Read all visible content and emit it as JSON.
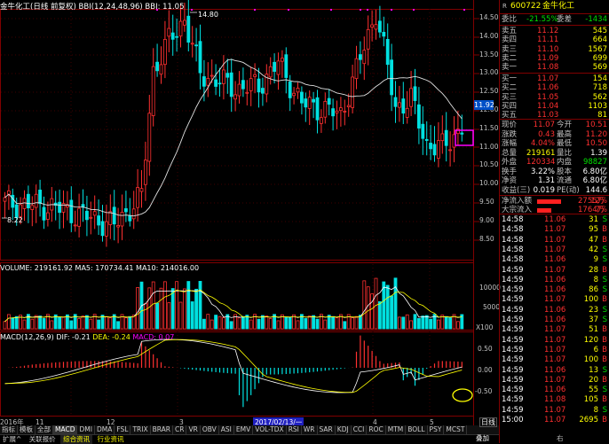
{
  "chart_header": {
    "title": "金牛化工(日线 前复权) BBI(12,24,48,96) BBI: 11.05",
    "high_marker": "14.80",
    "low_marker": "8.22"
  },
  "price_axis": [
    "14.50",
    "14.00",
    "13.50",
    "13.00",
    "12.50",
    "12.00",
    "11.50",
    "11.00",
    "10.50",
    "10.00",
    "9.50",
    "9.00",
    "8.50"
  ],
  "current_price_tag": "11.92",
  "volume_header": "VOLUME: 219161.92  MA5: 170734.41  MA10: 214016.00",
  "volume_axis": [
    "10000",
    "5000"
  ],
  "volume_unit": "X100",
  "macd_header": {
    "label": "MACD(12,26,9)",
    "dif": "DIF: -0.21",
    "dea": "DEA: -0.24",
    "macd": "MACD: 0.07"
  },
  "macd_axis": [
    "0.50",
    "0.00",
    "-0.50"
  ],
  "date_axis": {
    "year": "2016年",
    "m11": "11",
    "m12": "12",
    "m3": "3",
    "m4": "4",
    "m5": "5",
    "cursor_date": "2017/02/13/一"
  },
  "indicator_tabs": [
    "指标",
    "模板",
    "全部",
    "MACD",
    "DMI",
    "DMA",
    "FSL",
    "TRIX",
    "BRAR",
    "CR",
    "VR",
    "OBV",
    "ASI",
    "EMV",
    "VOL-TDX",
    "RSI",
    "WR",
    "SAR",
    "KDJ",
    "CCI",
    "ROC",
    "MTM",
    "BOLL",
    "PSY",
    "MCST"
  ],
  "bottom_tabs": [
    "扩展^",
    "关联报价",
    "综合资讯",
    "行业资讯"
  ],
  "side_buttons": {
    "daily": "日线",
    "fold": "叠加",
    "right": "右"
  },
  "stock": {
    "code": "600722",
    "name": "金牛化工",
    "prefix": "R"
  },
  "order_book": {
    "weibi": {
      "label": "委比",
      "value": "-21.55%",
      "label2": "委差",
      "value2": "-1434"
    },
    "asks": [
      {
        "label": "卖五",
        "price": "11.12",
        "vol": "545"
      },
      {
        "label": "卖四",
        "price": "11.11",
        "vol": "664"
      },
      {
        "label": "卖三",
        "price": "11.10",
        "vol": "1567"
      },
      {
        "label": "卖二",
        "price": "11.09",
        "vol": "699"
      },
      {
        "label": "卖一",
        "price": "11.08",
        "vol": "569"
      }
    ],
    "bids": [
      {
        "label": "买一",
        "price": "11.07",
        "vol": "154"
      },
      {
        "label": "买二",
        "price": "11.06",
        "vol": "718"
      },
      {
        "label": "买三",
        "price": "11.05",
        "vol": "562"
      },
      {
        "label": "买四",
        "price": "11.04",
        "vol": "1103"
      },
      {
        "label": "买五",
        "price": "11.03",
        "vol": "81"
      }
    ]
  },
  "quote": [
    {
      "l1": "现价",
      "v1": "11.07",
      "l2": "今开",
      "v2": "10.51"
    },
    {
      "l1": "涨跌",
      "v1": "0.43",
      "l2": "最高",
      "v2": "11.20"
    },
    {
      "l1": "涨幅",
      "v1": "4.04%",
      "l2": "最低",
      "v2": "10.50"
    },
    {
      "l1": "总量",
      "v1": "219161",
      "l2": "量比",
      "v2": "1.39"
    },
    {
      "l1": "外盘",
      "v1": "120334",
      "l2": "内盘",
      "v2": "98827"
    },
    {
      "l1": "换手",
      "v1": "3.22%",
      "l2": "股本",
      "v2": "6.80亿"
    },
    {
      "l1": "净资",
      "v1": "1.31",
      "l2": "流通",
      "v2": "6.80亿"
    },
    {
      "l1": "收益(三)",
      "v1": "0.019",
      "l2": "PE(动)",
      "v2": "144.6"
    }
  ],
  "flows": [
    {
      "label": "净流入额",
      "value": "2755万",
      "pct": "12%",
      "bar": 0.6
    },
    {
      "label": "大宗流入",
      "value": "1764万",
      "pct": "7%",
      "bar": 0.35
    }
  ],
  "ticks": [
    {
      "t": "14:58",
      "p": "11.06",
      "v": "31",
      "d": "S"
    },
    {
      "t": "14:58",
      "p": "11.07",
      "v": "95",
      "d": "B"
    },
    {
      "t": "14:58",
      "p": "11.07",
      "v": "47",
      "d": "B"
    },
    {
      "t": "14:58",
      "p": "11.07",
      "v": "42",
      "d": "S"
    },
    {
      "t": "14:58",
      "p": "11.06",
      "v": "9",
      "d": "S"
    },
    {
      "t": "14:59",
      "p": "11.07",
      "v": "28",
      "d": "B"
    },
    {
      "t": "14:59",
      "p": "11.06",
      "v": "8",
      "d": "S"
    },
    {
      "t": "14:59",
      "p": "11.06",
      "v": "86",
      "d": "S"
    },
    {
      "t": "14:59",
      "p": "11.07",
      "v": "100",
      "d": "B"
    },
    {
      "t": "14:59",
      "p": "11.06",
      "v": "23",
      "d": "S"
    },
    {
      "t": "14:59",
      "p": "11.06",
      "v": "37",
      "d": "S"
    },
    {
      "t": "14:59",
      "p": "11.07",
      "v": "51",
      "d": "B"
    },
    {
      "t": "14:59",
      "p": "11.07",
      "v": "120",
      "d": "B"
    },
    {
      "t": "14:59",
      "p": "11.07",
      "v": "6",
      "d": "B"
    },
    {
      "t": "14:59",
      "p": "11.07",
      "v": "100",
      "d": "B"
    },
    {
      "t": "14:59",
      "p": "11.06",
      "v": "13",
      "d": "S"
    },
    {
      "t": "14:59",
      "p": "11.07",
      "v": "20",
      "d": "B"
    },
    {
      "t": "14:59",
      "p": "11.06",
      "v": "55",
      "d": "S"
    },
    {
      "t": "14:59",
      "p": "11.08",
      "v": "105",
      "d": "B"
    },
    {
      "t": "14:59",
      "p": "11.07",
      "v": "8",
      "d": "S"
    },
    {
      "t": "15:00",
      "p": "11.07",
      "v": "2695",
      "d": "B"
    }
  ],
  "colors": {
    "up": "#ff3030",
    "down": "#00e0e0",
    "ma": "#ffffff",
    "bbi": "#ffff00",
    "border": "#800000"
  }
}
